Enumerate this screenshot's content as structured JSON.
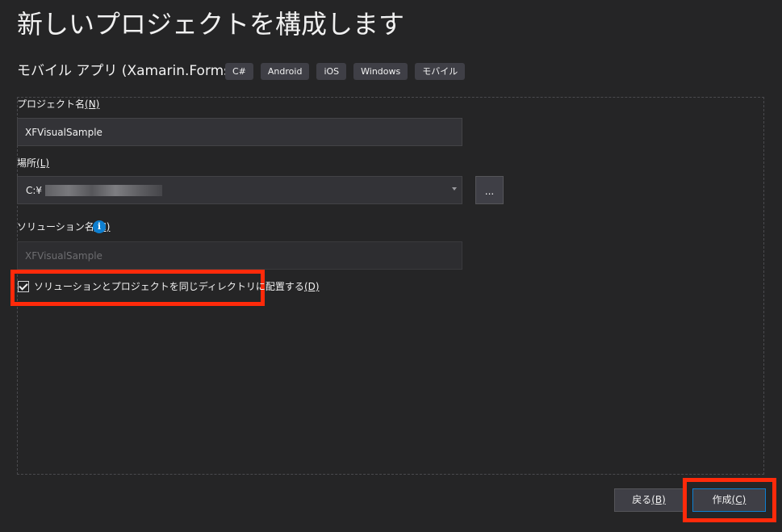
{
  "header": {
    "title": "新しいプロジェクトを構成します",
    "template_name": "モバイル アプリ (Xamarin.Forms)",
    "tags": [
      "C#",
      "Android",
      "iOS",
      "Windows",
      "モバイル"
    ]
  },
  "form": {
    "project_name": {
      "label": "プロジェクト名",
      "access_key": "(N)",
      "value": "XFVisualSample"
    },
    "location": {
      "label": "場所",
      "access_key": "(L)",
      "value_prefix": "C:¥",
      "browse_label": "..."
    },
    "solution_name": {
      "label": "ソリューション名",
      "access_key": "(M)",
      "value": "XFVisualSample",
      "info_glyph": "i"
    },
    "same_directory": {
      "label": "ソリューションとプロジェクトを同じディレクトリに配置する",
      "access_key": "(D)",
      "checked": true
    }
  },
  "footer": {
    "back_label": "戻る",
    "back_key": "(B)",
    "create_label": "作成",
    "create_key": "(C)"
  },
  "colors": {
    "background": "#252526",
    "highlight": "#ff2a0a",
    "accent": "#0e7fd0"
  },
  "icons": {
    "info": "info-icon",
    "dropdown": "chevron-down-icon",
    "check": "checkmark-icon"
  }
}
